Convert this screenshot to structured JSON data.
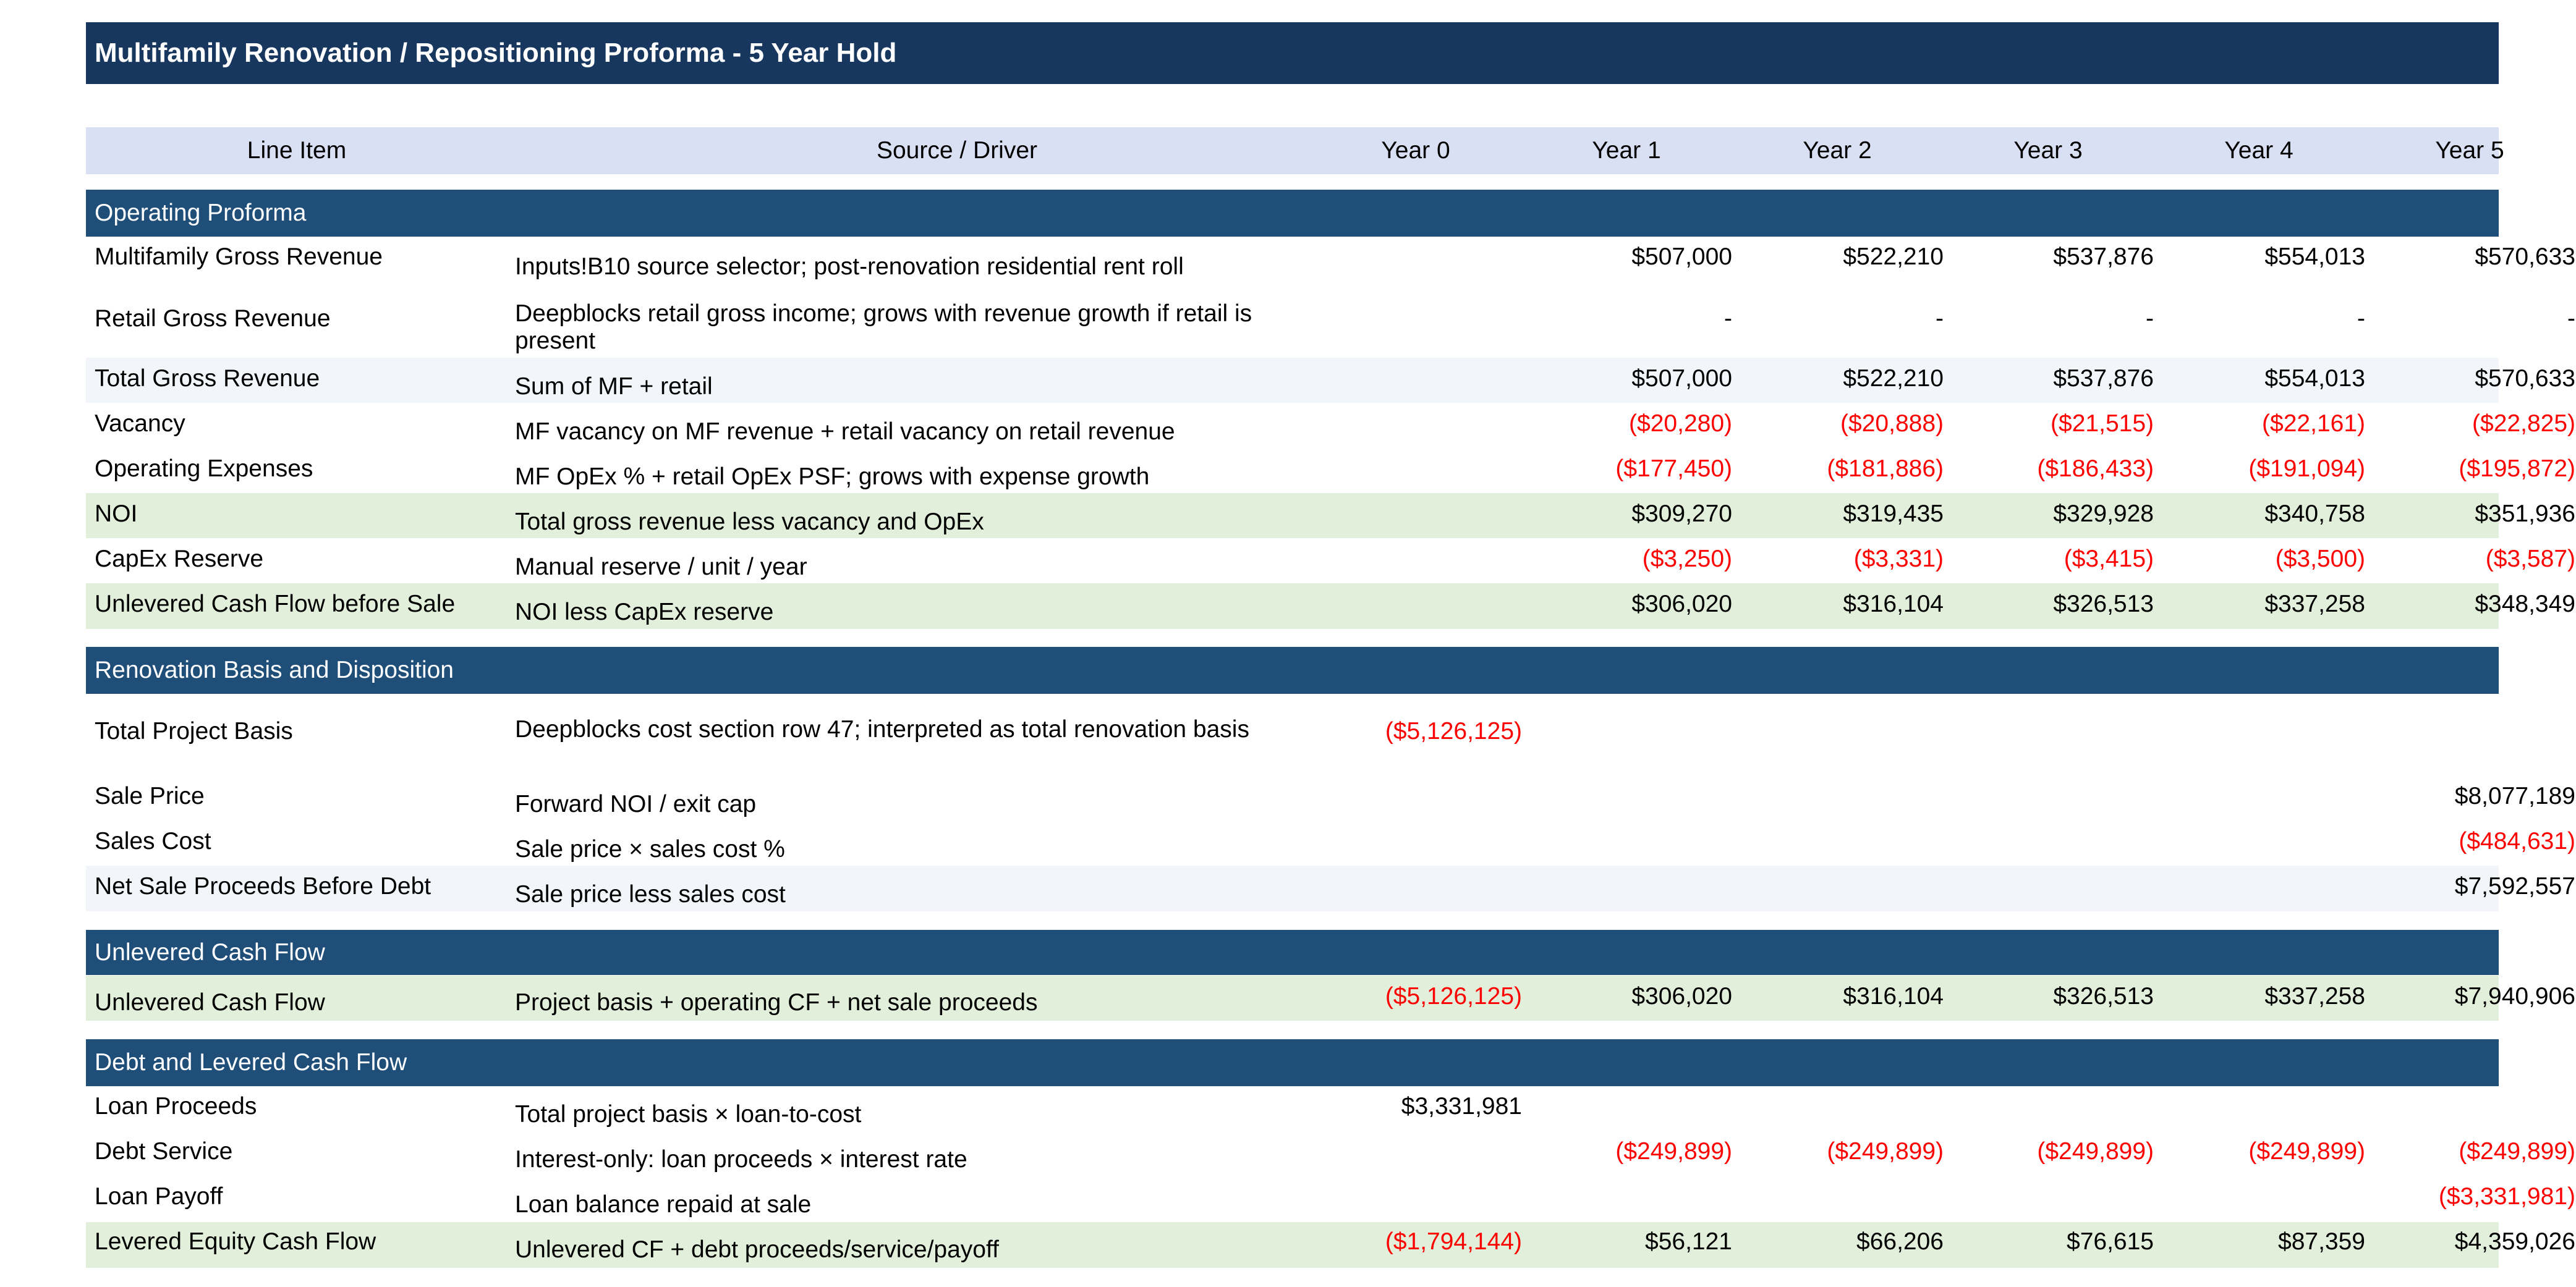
{
  "title": "Multifamily Renovation / Repositioning Proforma - 5 Year Hold",
  "header": {
    "line_item": "Line Item",
    "source": "Source / Driver",
    "years": [
      "Year 0",
      "Year 1",
      "Year 2",
      "Year 3",
      "Year 4",
      "Year 5"
    ]
  },
  "sections": [
    {
      "title": "Operating Proforma",
      "rows": [
        {
          "label": "Multifamily Gross Revenue",
          "source": "Inputs!B10 source selector; post-renovation residential rent roll",
          "values": [
            "",
            "$507,000",
            "$522,210",
            "$537,876",
            "$554,013",
            "$570,633"
          ]
        },
        {
          "label": "Retail Gross Revenue",
          "source": "Deepblocks retail gross income; grows with revenue growth if retail is present",
          "values": [
            "",
            "-",
            "-",
            "-",
            "-",
            "-"
          ]
        },
        {
          "label": "Total Gross Revenue",
          "source": "Sum of MF + retail",
          "values": [
            "",
            "$507,000",
            "$522,210",
            "$537,876",
            "$554,013",
            "$570,633"
          ]
        },
        {
          "label": "Vacancy",
          "source": "MF vacancy on MF revenue + retail vacancy on retail revenue",
          "values": [
            "",
            "($20,280)",
            "($20,888)",
            "($21,515)",
            "($22,161)",
            "($22,825)"
          ]
        },
        {
          "label": "Operating Expenses",
          "source": "MF OpEx % + retail OpEx PSF; grows with expense growth",
          "values": [
            "",
            "($177,450)",
            "($181,886)",
            "($186,433)",
            "($191,094)",
            "($195,872)"
          ]
        },
        {
          "label": "NOI",
          "source": "Total gross revenue less vacancy and OpEx",
          "values": [
            "",
            "$309,270",
            "$319,435",
            "$329,928",
            "$340,758",
            "$351,936"
          ]
        },
        {
          "label": "CapEx Reserve",
          "source": "Manual reserve / unit / year",
          "values": [
            "",
            "($3,250)",
            "($3,331)",
            "($3,415)",
            "($3,500)",
            "($3,587)"
          ]
        },
        {
          "label": "Unlevered Cash Flow before Sale",
          "source": "NOI less CapEx reserve",
          "values": [
            "",
            "$306,020",
            "$316,104",
            "$326,513",
            "$337,258",
            "$348,349"
          ]
        }
      ]
    },
    {
      "title": "Renovation Basis and Disposition",
      "rows": [
        {
          "label": "Total Project Basis",
          "source": "Deepblocks cost section row 47; interpreted as total renovation basis",
          "values": [
            "($5,126,125)",
            "",
            "",
            "",
            "",
            ""
          ]
        },
        {
          "label": "Sale Price",
          "source": "Forward NOI / exit cap",
          "values": [
            "",
            "",
            "",
            "",
            "",
            "$8,077,189"
          ]
        },
        {
          "label": "Sales Cost",
          "source": "Sale price × sales cost %",
          "values": [
            "",
            "",
            "",
            "",
            "",
            "($484,631)"
          ]
        },
        {
          "label": "Net Sale Proceeds Before Debt",
          "source": "Sale price less sales cost",
          "values": [
            "",
            "",
            "",
            "",
            "",
            "$7,592,557"
          ]
        }
      ]
    },
    {
      "title": "Unlevered Cash Flow",
      "rows": [
        {
          "label": "Unlevered Cash Flow",
          "source": "Project basis + operating CF + net sale proceeds",
          "values": [
            "($5,126,125)",
            "$306,020",
            "$316,104",
            "$326,513",
            "$337,258",
            "$7,940,906"
          ]
        }
      ]
    },
    {
      "title": "Debt and Levered Cash Flow",
      "rows": [
        {
          "label": "Loan Proceeds",
          "source": "Total project basis × loan-to-cost",
          "values": [
            "$3,331,981",
            "",
            "",
            "",
            "",
            ""
          ]
        },
        {
          "label": "Debt Service",
          "source": "Interest-only: loan proceeds × interest rate",
          "values": [
            "",
            "($249,899)",
            "($249,899)",
            "($249,899)",
            "($249,899)",
            "($249,899)"
          ]
        },
        {
          "label": "Loan Payoff",
          "source": "Loan balance repaid at sale",
          "values": [
            "",
            "",
            "",
            "",
            "",
            "($3,331,981)"
          ]
        },
        {
          "label": "Levered Equity Cash Flow",
          "source": "Unlevered CF + debt proceeds/service/payoff",
          "values": [
            "($1,794,144)",
            "$56,121",
            "$66,206",
            "$76,615",
            "$87,359",
            "$4,359,026"
          ]
        }
      ]
    }
  ],
  "colors": {
    "title_bg": "#17375e",
    "section_bg": "#1f4e79",
    "header_bg": "#dae0f3",
    "subtotal_bg": "#e2efda",
    "total_bg": "#f2f5fa",
    "negative_text": "#ff0000"
  }
}
